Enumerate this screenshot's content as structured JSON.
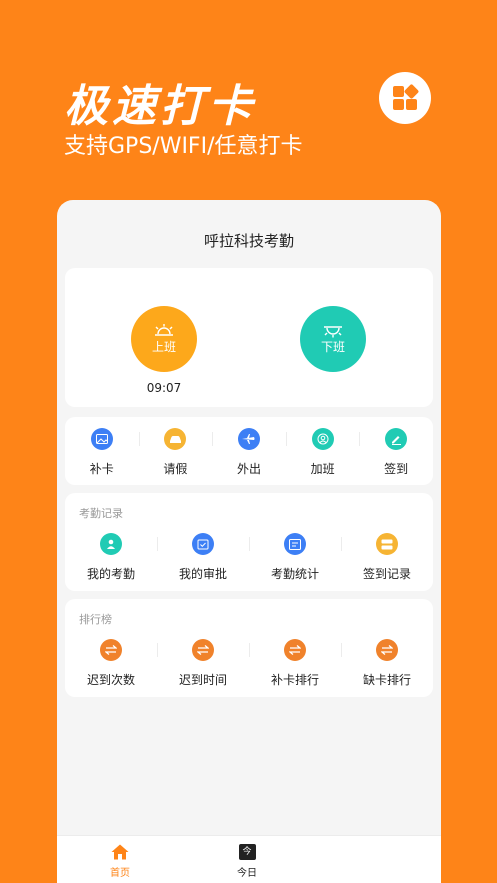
{
  "hero": {
    "title": "极速打卡",
    "subtitle": "支持GPS/WIFI/任意打卡"
  },
  "card": {
    "title": "呼拉科技考勤"
  },
  "clock": {
    "in_label": "上班",
    "out_label": "下班",
    "in_time": "09:07"
  },
  "actions": [
    {
      "label": "补卡",
      "color": "#3d7ff5",
      "icon": "image-icon"
    },
    {
      "label": "请假",
      "color": "#f6b433",
      "icon": "car-icon"
    },
    {
      "label": "外出",
      "color": "#3d7ff5",
      "icon": "plane-icon"
    },
    {
      "label": "加班",
      "color": "#20cbb4",
      "icon": "person-icon"
    },
    {
      "label": "签到",
      "color": "#20cbb4",
      "icon": "pen-icon"
    }
  ],
  "records": {
    "heading": "考勤记录",
    "items": [
      {
        "label": "我的考勤",
        "color": "#20cbb4",
        "icon": "user-icon"
      },
      {
        "label": "我的审批",
        "color": "#3d7ff5",
        "icon": "calendar-check-icon"
      },
      {
        "label": "考勤统计",
        "color": "#3d7ff5",
        "icon": "chart-icon"
      },
      {
        "label": "签到记录",
        "color": "#f6b433",
        "icon": "list-icon"
      }
    ]
  },
  "ranking": {
    "heading": "排行榜",
    "items": [
      {
        "label": "迟到次数",
        "color": "#f0822b",
        "icon": "swap-icon"
      },
      {
        "label": "迟到时间",
        "color": "#f0822b",
        "icon": "swap-icon"
      },
      {
        "label": "补卡排行",
        "color": "#f0822b",
        "icon": "swap-icon"
      },
      {
        "label": "缺卡排行",
        "color": "#f0822b",
        "icon": "swap-icon"
      }
    ]
  },
  "nav": {
    "home": "首页",
    "today": "今日",
    "today_icon_text": "今",
    "active_color": "#fe8418"
  }
}
